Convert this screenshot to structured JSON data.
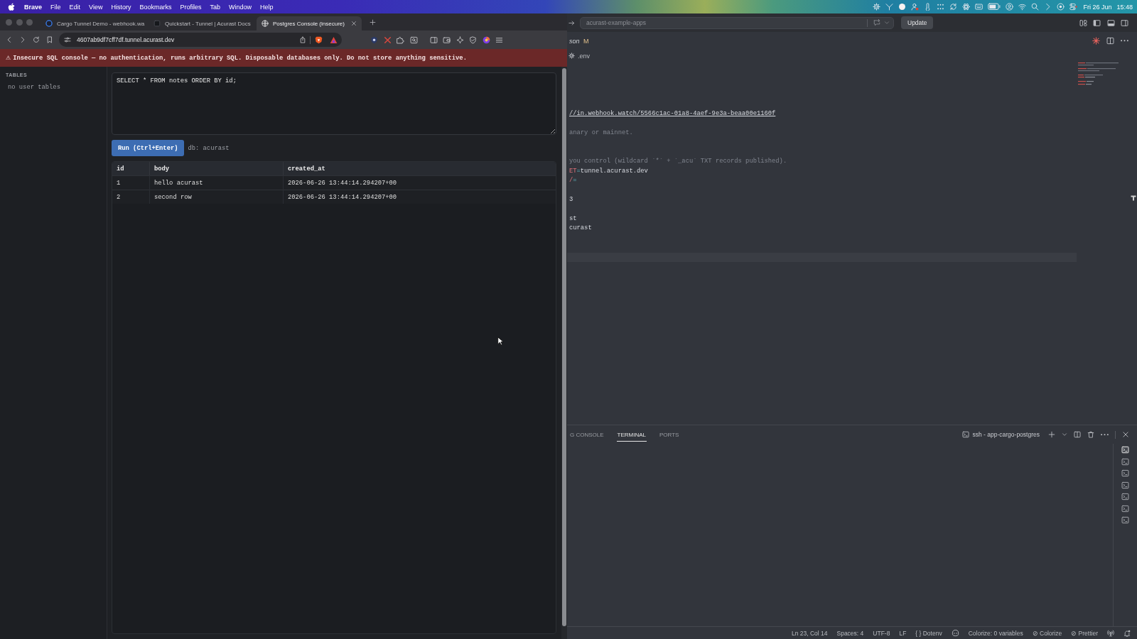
{
  "menu_bar": {
    "app": "Brave",
    "menus": [
      "File",
      "Edit",
      "View",
      "History",
      "Bookmarks",
      "Profiles",
      "Tab",
      "Window",
      "Help"
    ],
    "date": "Fri 26 Jun",
    "time": "15:48"
  },
  "browser": {
    "tabs": [
      {
        "title": "Cargo Tunnel Demo - webhook.wa",
        "selected": false
      },
      {
        "title": "Quickstart - Tunnel | Acurast Docs",
        "selected": false
      },
      {
        "title": "Postgres Console (insecure)",
        "selected": true
      }
    ],
    "address": "4607ab9df7cff7df.tunnel.acurast.dev",
    "warning": {
      "icon": "⚠",
      "text": "Insecure SQL console — no authentication, runs arbitrary SQL. Disposable databases only. Do not store anything sensitive."
    },
    "sidebar": {
      "heading": "TABLES",
      "empty_text": "no user tables"
    },
    "query": {
      "value": "SELECT * FROM notes ORDER BY id;"
    },
    "run_button": "Run (Ctrl+Enter)",
    "db_label": "db: acurast",
    "results": {
      "columns": [
        "id",
        "body",
        "created_at"
      ],
      "rows": [
        [
          "1",
          "hello acurast",
          "2026-06-26 13:44:14.294207+00"
        ],
        [
          "2",
          "second row",
          "2026-06-26 13:44:14.294207+00"
        ]
      ]
    }
  },
  "editor": {
    "command_center": "acurast-example-apps",
    "update_button": "Update",
    "tab": {
      "title": "son",
      "status": "M"
    },
    "breadcrumb": ".env",
    "lines": [
      {
        "kind": "text",
        "tokens": [
          {
            "kind": "link",
            "text": "//in.webhook.watch/5566c1ac-01a8-4aef-9e3a-beaa00e1160f"
          }
        ]
      },
      {
        "kind": "blank"
      },
      {
        "kind": "text",
        "tokens": [
          {
            "kind": "comment",
            "text": "anary or mainnet."
          }
        ]
      },
      {
        "kind": "blank"
      },
      {
        "kind": "blank"
      },
      {
        "kind": "text",
        "tokens": [
          {
            "kind": "comment",
            "text": "you control (wildcard `*` + `_acu` TXT records published)."
          }
        ]
      },
      {
        "kind": "text",
        "tokens": [
          {
            "kind": "key",
            "text": "ET"
          },
          {
            "kind": "operator",
            "text": "="
          },
          {
            "kind": "value",
            "text": "tunnel.acurast.dev"
          }
        ]
      },
      {
        "kind": "text",
        "tokens": [
          {
            "kind": "key",
            "text": "/"
          },
          {
            "kind": "operator",
            "text": "="
          }
        ]
      },
      {
        "kind": "blank"
      },
      {
        "kind": "text",
        "tokens": [
          {
            "kind": "value",
            "text": "3"
          }
        ]
      },
      {
        "kind": "blank"
      },
      {
        "kind": "text",
        "tokens": [
          {
            "kind": "value",
            "text": "st"
          }
        ]
      },
      {
        "kind": "text",
        "tokens": [
          {
            "kind": "value",
            "text": "curast"
          }
        ]
      },
      {
        "kind": "blank"
      },
      {
        "kind": "blank"
      },
      {
        "kind": "current"
      }
    ],
    "panel": {
      "tabs": [
        {
          "label": "G CONSOLE",
          "selected": false
        },
        {
          "label": "TERMINAL",
          "selected": true
        },
        {
          "label": "PORTS",
          "selected": false
        }
      ],
      "terminal_name": "ssh - app-cargo-postgres",
      "terminals": [
        {
          "selected": true
        },
        {
          "selected": false
        },
        {
          "selected": false
        },
        {
          "selected": false
        },
        {
          "selected": false
        },
        {
          "selected": false
        },
        {
          "selected": false
        }
      ]
    },
    "status_bar": {
      "items": [
        "Ln 23, Col 14",
        "Spaces: 4",
        "UTF-8",
        "LF",
        "{ } Dotenv"
      ],
      "colorize_info": "Colorize: 0 variables",
      "colorize": "⊘ Colorize",
      "prettier": "⊘ Prettier"
    }
  }
}
